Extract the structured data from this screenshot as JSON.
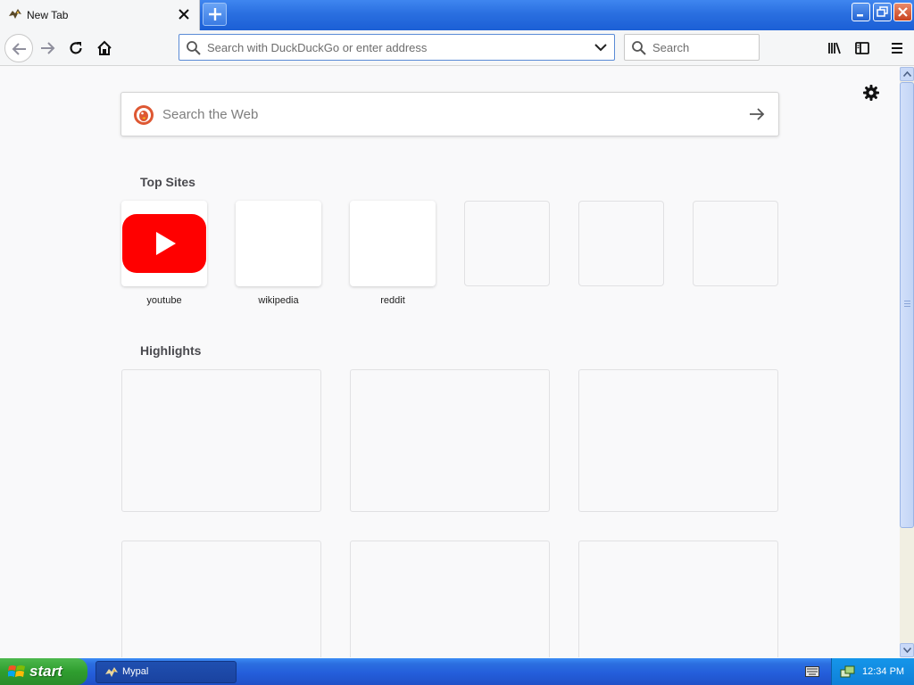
{
  "tab": {
    "title": "New Tab"
  },
  "toolbar": {
    "address_placeholder": "Search with DuckDuckGo or enter address",
    "search_placeholder": "Search"
  },
  "newtab_page": {
    "web_search_placeholder": "Search the Web",
    "top_sites_title": "Top Sites",
    "top_sites": [
      {
        "label": "youtube"
      },
      {
        "label": "wikipedia"
      },
      {
        "label": "reddit"
      }
    ],
    "highlights_title": "Highlights"
  },
  "taskbar": {
    "start_label": "start",
    "task_label": "Mypal",
    "clock": "12:34 PM"
  },
  "colors": {
    "youtube_red": "#ff0000",
    "ddg_orange": "#de5833",
    "xp_blue": "#245edb",
    "start_green": "#2f9e2f"
  },
  "icons": [
    "mypal-icon",
    "close-icon",
    "plus-icon",
    "minimize-icon",
    "restore-icon",
    "close-window-icon",
    "back-arrow-icon",
    "forward-arrow-icon",
    "reload-icon",
    "home-icon",
    "search-icon",
    "chevron-down-icon",
    "library-icon",
    "sidebar-icon",
    "hamburger-menu-icon",
    "gear-icon",
    "duckduckgo-logo",
    "arrow-right-icon",
    "youtube-logo",
    "windows-flag-icon",
    "keyboard-icon",
    "network-icon"
  ]
}
